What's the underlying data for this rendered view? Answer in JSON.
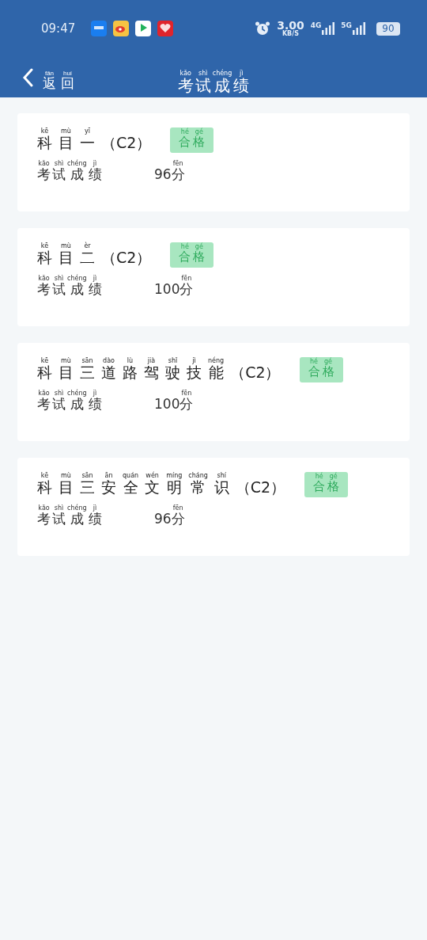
{
  "status_bar": {
    "time": "09:47",
    "speed": "3.00",
    "speed_unit": "KB/S",
    "network_1": "4G",
    "network_2": "5G",
    "battery": "90"
  },
  "nav": {
    "back": [
      {
        "c": "返",
        "py": "fǎn"
      },
      {
        "c": "回",
        "py": "huí"
      }
    ],
    "title": [
      {
        "c": "考",
        "py": "kǎo"
      },
      {
        "c": "试",
        "py": "shì"
      },
      {
        "c": "成",
        "py": "chéng"
      },
      {
        "c": "绩",
        "py": "jì"
      }
    ]
  },
  "results": [
    {
      "title": [
        [
          {
            "c": "科",
            "py": "kē"
          },
          {
            "c": "目",
            "py": "mù"
          },
          {
            "c": "一",
            "py": "yī"
          }
        ],
        [
          {
            "c": "（C2）"
          }
        ]
      ],
      "badge": [
        {
          "c": "合",
          "py": "hé"
        },
        {
          "c": "格",
          "py": "gé"
        }
      ],
      "label": [
        {
          "c": "考",
          "py": "kǎo"
        },
        {
          "c": "试",
          "py": "shì"
        },
        {
          "c": "成",
          "py": "chéng"
        },
        {
          "c": "绩",
          "py": "jì"
        }
      ],
      "score": [
        {
          "c": "96"
        },
        {
          "c": "分",
          "py": "fēn"
        }
      ]
    },
    {
      "title": [
        [
          {
            "c": "科",
            "py": "kē"
          },
          {
            "c": "目",
            "py": "mù"
          },
          {
            "c": "二",
            "py": "èr"
          }
        ],
        [
          {
            "c": "（C2）"
          }
        ]
      ],
      "badge": [
        {
          "c": "合",
          "py": "hé"
        },
        {
          "c": "格",
          "py": "gé"
        }
      ],
      "label": [
        {
          "c": "考",
          "py": "kǎo"
        },
        {
          "c": "试",
          "py": "shì"
        },
        {
          "c": "成",
          "py": "chéng"
        },
        {
          "c": "绩",
          "py": "jì"
        }
      ],
      "score": [
        {
          "c": "100"
        },
        {
          "c": "分",
          "py": "fēn"
        }
      ]
    },
    {
      "title": [
        [
          {
            "c": "科",
            "py": "kē"
          },
          {
            "c": "目",
            "py": "mù"
          },
          {
            "c": "三",
            "py": "sān"
          }
        ],
        [
          {
            "c": "道",
            "py": "dào"
          },
          {
            "c": "路",
            "py": "lù"
          },
          {
            "c": "驾",
            "py": "jià"
          },
          {
            "c": "驶",
            "py": "shǐ"
          },
          {
            "c": "技",
            "py": "jì"
          },
          {
            "c": "能",
            "py": "néng"
          }
        ],
        [
          {
            "c": "（C2）"
          }
        ]
      ],
      "badge": [
        {
          "c": "合",
          "py": "hé"
        },
        {
          "c": "格",
          "py": "gé"
        }
      ],
      "label": [
        {
          "c": "考",
          "py": "kǎo"
        },
        {
          "c": "试",
          "py": "shì"
        },
        {
          "c": "成",
          "py": "chéng"
        },
        {
          "c": "绩",
          "py": "jì"
        }
      ],
      "score": [
        {
          "c": "100"
        },
        {
          "c": "分",
          "py": "fēn"
        }
      ]
    },
    {
      "title": [
        [
          {
            "c": "科",
            "py": "kē"
          },
          {
            "c": "目",
            "py": "mù"
          },
          {
            "c": "三",
            "py": "sān"
          }
        ],
        [
          {
            "c": "安",
            "py": "ān"
          },
          {
            "c": "全",
            "py": "quán"
          },
          {
            "c": "文",
            "py": "wén"
          },
          {
            "c": "明",
            "py": "míng"
          },
          {
            "c": "常",
            "py": "cháng"
          },
          {
            "c": "识",
            "py": "shí"
          }
        ],
        [
          {
            "c": "（C2）"
          }
        ]
      ],
      "badge": [
        {
          "c": "合",
          "py": "hé"
        },
        {
          "c": "格",
          "py": "gé"
        }
      ],
      "label": [
        {
          "c": "考",
          "py": "kǎo"
        },
        {
          "c": "试",
          "py": "shì"
        },
        {
          "c": "成",
          "py": "chéng"
        },
        {
          "c": "绩",
          "py": "jì"
        }
      ],
      "score": [
        {
          "c": "96"
        },
        {
          "c": "分",
          "py": "fēn"
        }
      ]
    }
  ]
}
